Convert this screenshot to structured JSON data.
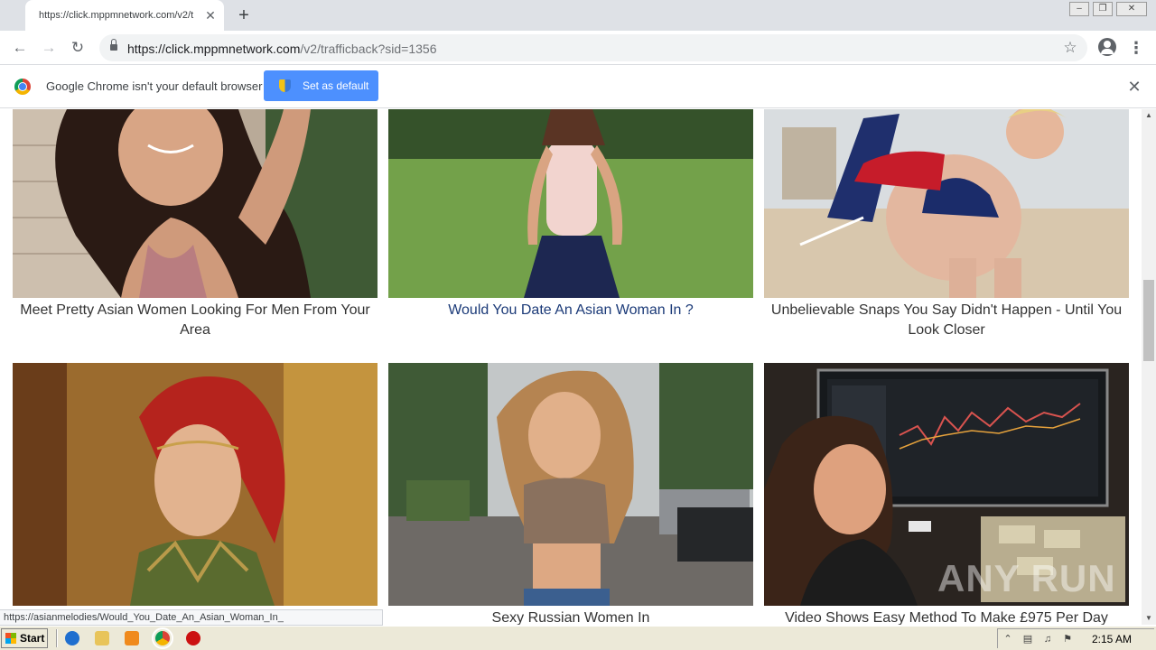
{
  "browser": {
    "tab_title": "https://click.mppmnetwork.com/v2/t",
    "tab_close_glyph": "✕",
    "new_tab_glyph": "+",
    "url_host": "https://click.mppmnetwork.com",
    "url_rest": "/v2/trafficback?sid=1356",
    "window_controls": [
      "minimize",
      "restore",
      "close"
    ]
  },
  "infobar": {
    "message": "Google Chrome isn't your default browser",
    "button_label": "Set as default",
    "close_glyph": "✕"
  },
  "cards": [
    {
      "title": "Meet Pretty Asian Women Looking For Men From Your Area",
      "is_link_color": false,
      "image": "woman-selfie-arm-raised"
    },
    {
      "title": "Would You Date An Asian Woman In ?",
      "is_link_color": true,
      "image": "woman-white-top-on-lawn"
    },
    {
      "title": "Unbelievable Snaps You Say Didn't Happen - Until You Look Closer",
      "is_link_color": false,
      "image": "woman-flag-bikini-beach"
    },
    {
      "title": "Sexy Russian Women In",
      "is_link_color": false,
      "image": "red-haired-cosplay"
    },
    {
      "title": "Video Shows Easy Method To Make £975 Per Day",
      "is_link_color": false,
      "image": "woman-with-trading-monitor"
    },
    {
      "title": "",
      "is_link_color": false,
      "image": "woman-street-crop-top"
    }
  ],
  "status_url": "https://asianmelodies/Would_You_Date_An_Asian_Woman_In_",
  "watermark": "ANY RUN",
  "taskbar": {
    "start_label": "Start",
    "clock": "2:15 AM",
    "pinned_icons": [
      "ie-icon",
      "folder-icon",
      "media-player-icon",
      "chrome-icon",
      "stop-icon"
    ]
  },
  "colors": {
    "link_title": "#1b3a78",
    "card_title": "#333333",
    "infobar_button": "#4d90fe"
  }
}
